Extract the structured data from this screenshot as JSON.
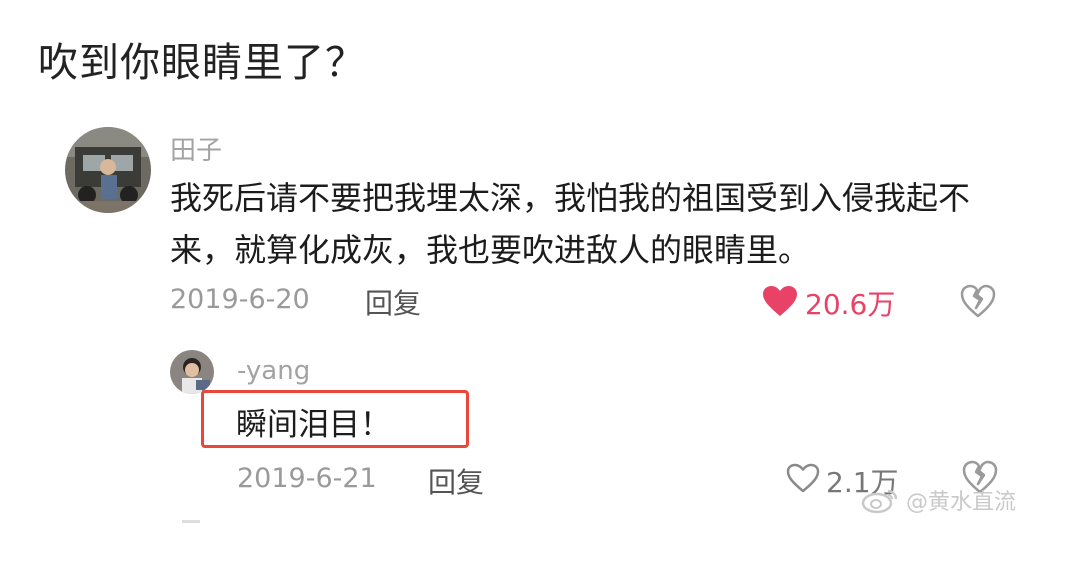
{
  "post": {
    "title": "吹到你眼睛里了？"
  },
  "comment": {
    "username": "田子",
    "text": "我死后请不要把我埋太深，我怕我的祖国受到入侵我起不来，就算化成灰，我也要吹进敌人的眼睛里。",
    "date": "2019-6-20",
    "reply_label": "回复",
    "likes": "20.6万",
    "liked": true,
    "icons": [
      "heart-icon",
      "dislike-heart-icon"
    ]
  },
  "reply": {
    "username": "-yang",
    "text": "瞬间泪目！",
    "date": "2019-6-21",
    "reply_label": "回复",
    "likes": "2.1万",
    "liked": false
  },
  "watermark": {
    "text": "@黄水直流"
  },
  "colors": {
    "liked_heart": "#e84266",
    "highlight_box": "#e9473a",
    "meta_text": "#9a9a9a"
  }
}
